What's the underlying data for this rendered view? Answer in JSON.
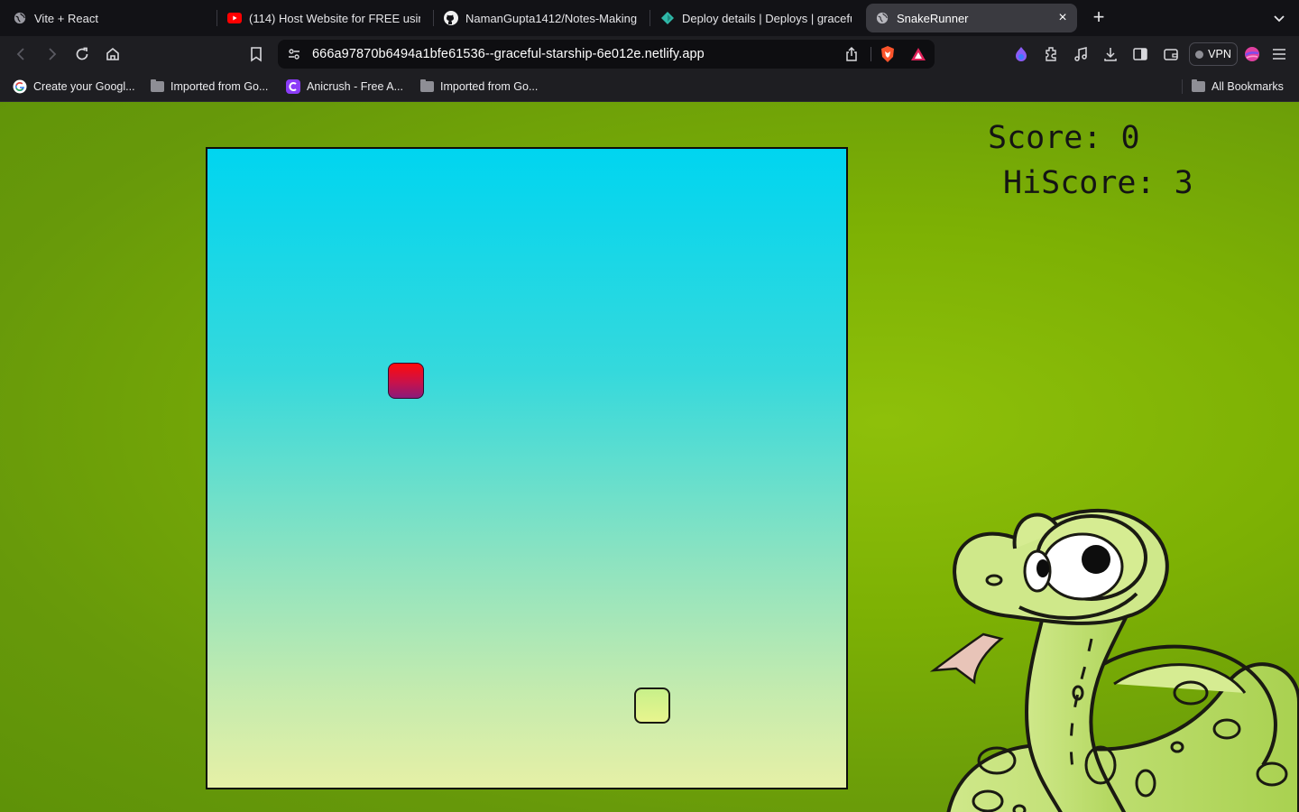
{
  "tabs": [
    {
      "title": "Vite + React",
      "icon": "globe-icon"
    },
    {
      "title": "(114) Host Website for FREE using",
      "icon": "youtube-icon"
    },
    {
      "title": "NamanGupta1412/Notes-Making",
      "icon": "github-icon"
    },
    {
      "title": "Deploy details | Deploys | graceful",
      "icon": "netlify-icon"
    },
    {
      "title": "SnakeRunner",
      "icon": "globe-icon",
      "active": true
    }
  ],
  "address": {
    "url": "666a97870b6494a1bfe61536--graceful-starship-6e012e.netlify.app"
  },
  "toolbar": {
    "vpn_label": "VPN"
  },
  "bookmarks": {
    "items": [
      {
        "label": "Create your Googl...",
        "icon": "google-icon"
      },
      {
        "label": "Imported from Go...",
        "icon": "folder-icon"
      },
      {
        "label": "Anicrush - Free A...",
        "icon": "anicrush-icon"
      },
      {
        "label": "Imported from Go...",
        "icon": "folder-icon"
      }
    ],
    "all_bookmarks": "All Bookmarks"
  },
  "game": {
    "score_text": "Score: 0",
    "hiscore_text": "HiScore: 3",
    "grid_size": 18,
    "food": {
      "col": 5,
      "row": 6
    },
    "snake": [
      {
        "col": 12,
        "row": 15
      }
    ],
    "colors": {
      "page_bg": "#7db104",
      "board_top": "#00d5f0",
      "board_bottom": "#e6f0a6",
      "food_top": "#ff0a0a",
      "food_bottom": "#8a1a7a",
      "snake": "#d4f28c"
    }
  }
}
